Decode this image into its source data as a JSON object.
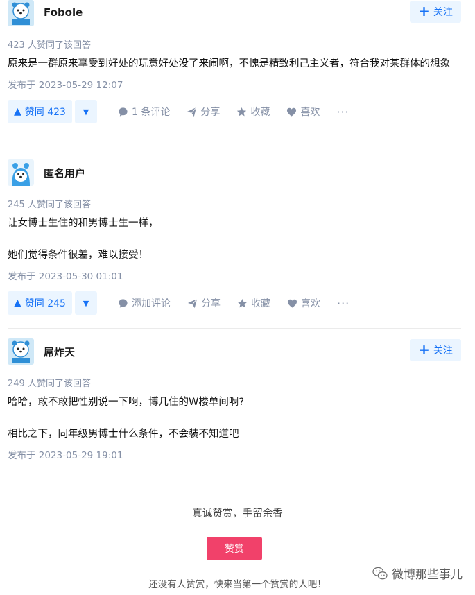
{
  "answers": [
    {
      "author": "Fobole",
      "follow_label": "关注",
      "show_follow": true,
      "votes_text": "423 人赞同了该回答",
      "paragraphs": [
        "原来是一群原来享受到好处的玩意好处没了来闹啊，不愧是精致利己主义者，符合我对某群体的想象"
      ],
      "published": "发布于 2023-05-29 12:07",
      "vote_label": "赞同 423",
      "comment_label": "1 条评论",
      "share_label": "分享",
      "collect_label": "收藏",
      "like_label": "喜欢",
      "more_label": "···"
    },
    {
      "author": "匿名用户",
      "show_follow": false,
      "votes_text": "245 人赞同了该回答",
      "paragraphs": [
        "让女博士生住的和男博士生一样，",
        "她们觉得条件很差，难以接受！"
      ],
      "published": "发布于 2023-05-30 01:01",
      "vote_label": "赞同 245",
      "comment_label": "添加评论",
      "share_label": "分享",
      "collect_label": "收藏",
      "like_label": "喜欢",
      "more_label": "···"
    },
    {
      "author": "屌炸天",
      "follow_label": "关注",
      "show_follow": true,
      "votes_text": "249 人赞同了该回答",
      "paragraphs": [
        "哈哈，敢不敢把性别说一下啊，博几住的W楼单间啊?",
        "相比之下，同年级男博士什么条件，不会装不知道吧"
      ],
      "published": "发布于 2023-05-29 19:01"
    }
  ],
  "reward": {
    "title": "真诚赞赏，手留余香",
    "button": "赞赏",
    "note": "还没有人赞赏，快来当第一个赞赏的人吧！"
  },
  "watermark": {
    "text": "微博那些事儿",
    "icon": "wechat-icon"
  },
  "colors": {
    "accent": "#1772f6",
    "accent_bg": "#ebf5ff",
    "reward": "#f1416a",
    "meta": "#8590a6"
  }
}
